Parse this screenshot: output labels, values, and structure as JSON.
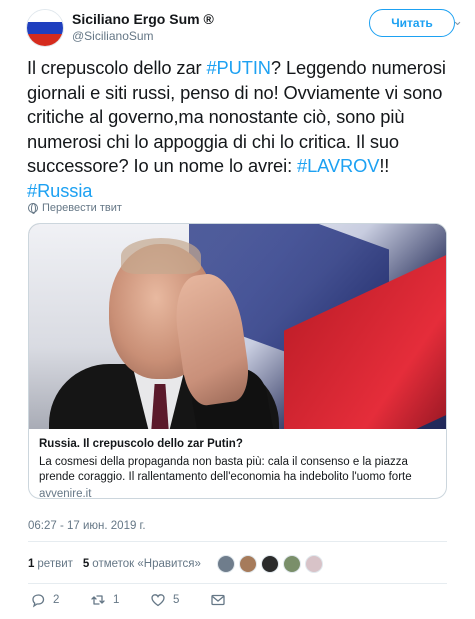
{
  "header": {
    "display_name": "Siciliano Ergo Sum ®",
    "handle": "@SicilianoSum",
    "follow_label": "Читать",
    "menu_icon": "chevron-down-icon",
    "avatar_colors": [
      "#ffffff",
      "#1f3fbf",
      "#d52b1e"
    ]
  },
  "tweet": {
    "text_parts": [
      {
        "type": "text",
        "value": "Il crepuscolo dello zar "
      },
      {
        "type": "tag",
        "value": "#PUTIN"
      },
      {
        "type": "text",
        "value": "? Leggendo numerosi giornali e siti russi, penso di no! Ovviamente vi sono critiche al governo,ma nonostante ciò, sono più numerosi chi lo appoggia di chi lo critica. Il suo successore? Io un nome lo avrei: "
      },
      {
        "type": "tag",
        "value": "#LAVROV"
      },
      {
        "type": "text",
        "value": "!! "
      },
      {
        "type": "tag",
        "value": "#Russia"
      }
    ],
    "translate_label": "Перевести твит"
  },
  "card": {
    "title": "Russia. Il crepuscolo dello zar Putin?",
    "description": "La cosmesi della propaganda non basta più: cala il consenso e la piazza prende coraggio. Il rallentamento dell'economia ha indebolito l'uomo forte",
    "domain": "avvenire.it"
  },
  "timestamp": "06:27 - 17 июн. 2019 г.",
  "stats": {
    "retweets_count": "1",
    "retweets_label": "ретвит",
    "likes_count": "5",
    "likes_label": "отметок «Нравится»"
  },
  "liker_colors": [
    "#6f7d8c",
    "#a67b5b",
    "#2b2b2b",
    "#7a8f6a",
    "#d8c3c8"
  ],
  "actions": {
    "replies": "2",
    "retweets": "1",
    "likes": "5"
  },
  "colors": {
    "accent": "#1da1f2",
    "text": "#14171a",
    "muted": "#657786"
  }
}
